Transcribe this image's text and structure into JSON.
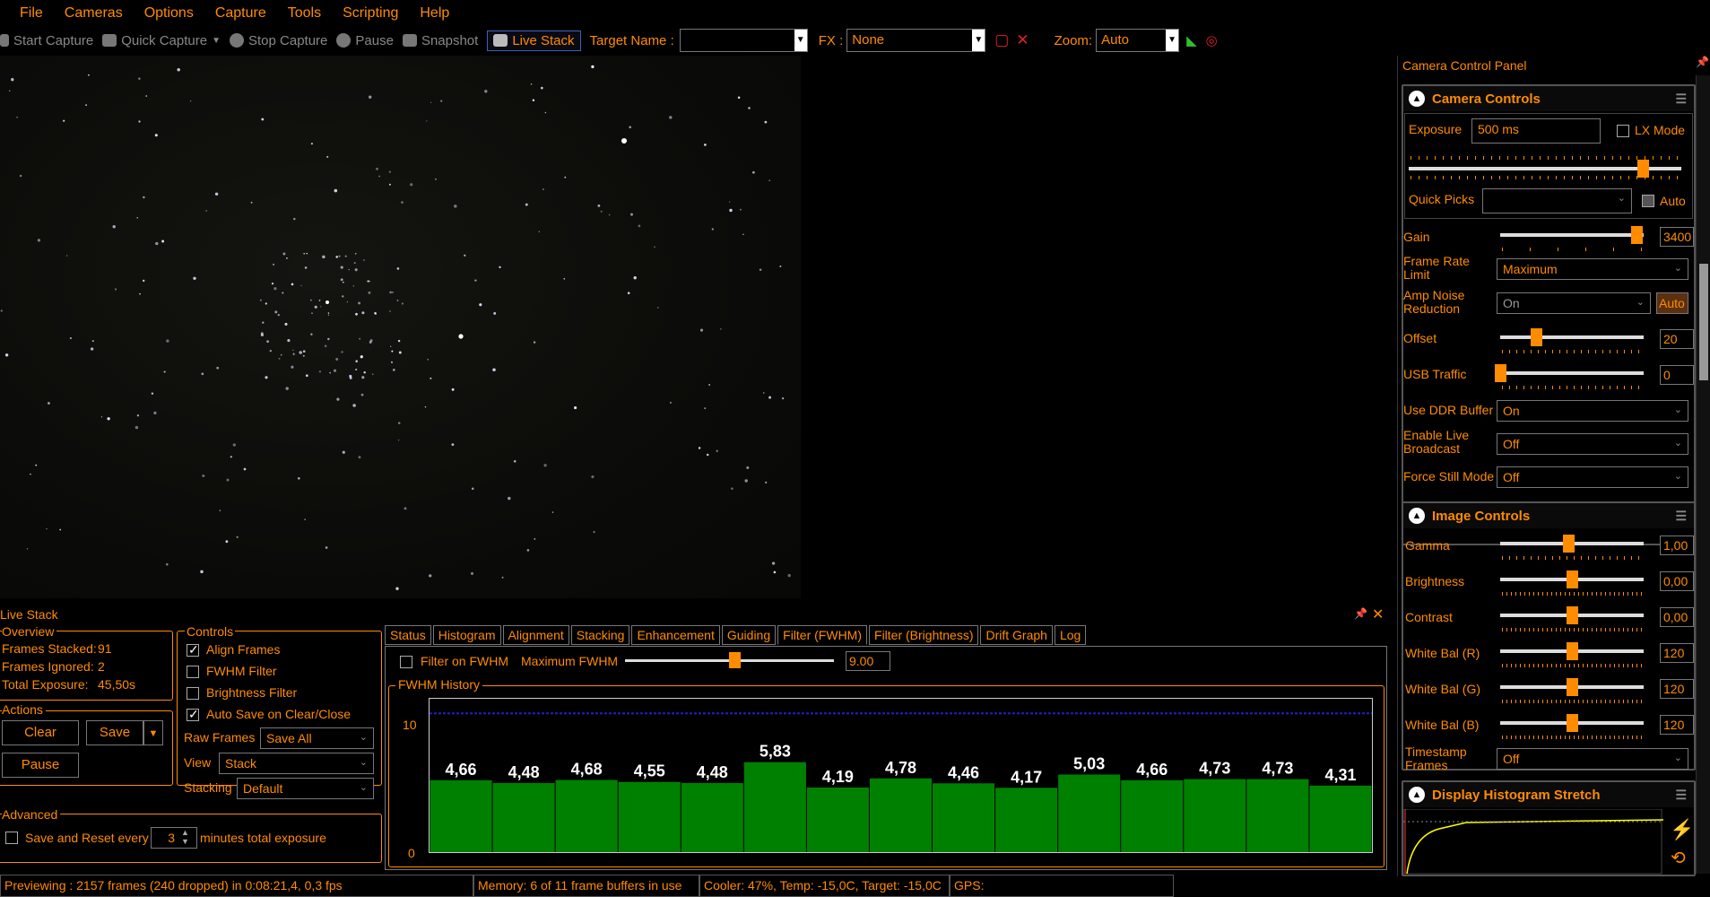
{
  "menu": [
    "File",
    "Cameras",
    "Options",
    "Capture",
    "Tools",
    "Scripting",
    "Help"
  ],
  "toolbar": {
    "start_capture": "Start Capture",
    "quick_capture": "Quick Capture",
    "stop_capture": "Stop Capture",
    "pause": "Pause",
    "snapshot": "Snapshot",
    "live_stack": "Live Stack",
    "target_label": "Target Name :",
    "target_value": "",
    "fx_label": "FX :",
    "fx_value": "None",
    "zoom_label": "Zoom:",
    "zoom_value": "Auto"
  },
  "camera_panel": {
    "title": "Camera Control Panel",
    "camera_controls": {
      "title": "Camera Controls",
      "exposure_label": "Exposure",
      "exposure_value": "500 ms",
      "lx_mode": "LX Mode",
      "quick_picks": "Quick Picks",
      "quick_picks_value": "",
      "auto": "Auto",
      "gain_label": "Gain",
      "gain_value": "3400",
      "frame_rate_label": "Frame Rate Limit",
      "frame_rate_value": "Maximum",
      "amp_noise_label": "Amp Noise Reduction",
      "amp_noise_value": "On",
      "amp_auto": "Auto",
      "offset_label": "Offset",
      "offset_value": "20",
      "usb_label": "USB Traffic",
      "usb_value": "0",
      "ddr_label": "Use DDR Buffer",
      "ddr_value": "On",
      "live_broadcast_label": "Enable Live Broadcast",
      "live_broadcast_value": "Off",
      "force_still_label": "Force Still Mode",
      "force_still_value": "Off"
    },
    "image_controls": {
      "title": "Image Controls",
      "gamma_label": "Gamma",
      "gamma_value": "1,00",
      "brightness_label": "Brightness",
      "brightness_value": "0,00",
      "contrast_label": "Contrast",
      "contrast_value": "0,00",
      "wbr_label": "White Bal (R)",
      "wbr_value": "120",
      "wbg_label": "White Bal (G)",
      "wbg_value": "120",
      "wbb_label": "White Bal (B)",
      "wbb_value": "120",
      "timestamp_label": "Timestamp Frames",
      "timestamp_value": "Off"
    },
    "histogram_stretch": {
      "title": "Display Histogram Stretch"
    }
  },
  "live_stack": {
    "title": "Live Stack",
    "overview": {
      "title": "Overview",
      "frames_stacked_label": "Frames Stacked:",
      "frames_stacked": "91",
      "frames_ignored_label": "Frames Ignored:",
      "frames_ignored": "2",
      "total_exposure_label": "Total Exposure:",
      "total_exposure": "45,50s"
    },
    "controls": {
      "title": "Controls",
      "align_frames": "Align Frames",
      "fwhm_filter": "FWHM Filter",
      "brightness_filter": "Brightness Filter",
      "auto_save": "Auto Save on Clear/Close",
      "raw_frames_label": "Raw Frames",
      "raw_frames_value": "Save All",
      "view_label": "View",
      "view_value": "Stack",
      "stacking_label": "Stacking",
      "stacking_value": "Default"
    },
    "actions": {
      "title": "Actions",
      "clear": "Clear",
      "save": "Save",
      "pause": "Pause"
    },
    "advanced": {
      "title": "Advanced",
      "save_reset_label": "Save and Reset every",
      "save_reset_value": "3",
      "minutes_label": "minutes total exposure"
    },
    "tabs": [
      "Status",
      "Histogram",
      "Alignment",
      "Stacking",
      "Enhancement",
      "Guiding",
      "Filter (FWHM)",
      "Filter (Brightness)",
      "Drift Graph",
      "Log"
    ],
    "active_tab": "Filter (FWHM)",
    "fwhm": {
      "filter_on_label": "Filter on FWHM",
      "max_label": "Maximum FWHM",
      "max_value": "9.00",
      "history_title": "FWHM History"
    }
  },
  "chart_data": {
    "type": "bar",
    "title": "FWHM History",
    "ylim": [
      0,
      10
    ],
    "y_ticks": [
      "10",
      "0"
    ],
    "threshold": 9.0,
    "values": [
      4.66,
      4.48,
      4.68,
      4.55,
      4.48,
      5.83,
      4.19,
      4.78,
      4.46,
      4.17,
      5.03,
      4.66,
      4.73,
      4.73,
      4.31
    ],
    "labels": [
      "4,66",
      "4,48",
      "4,68",
      "4,55",
      "4,48",
      "5,83",
      "4,19",
      "4,78",
      "4,46",
      "4,17",
      "5,03",
      "4,66",
      "4,73",
      "4,73",
      "4,31"
    ],
    "bar_color": "#008000"
  },
  "status": {
    "preview": "Previewing : 2157 frames (240 dropped) in 0:08:21,4, 0,3 fps",
    "memory": "Memory: 6 of 11 frame buffers in use",
    "cooler": "Cooler: 47%, Temp: -15,0C, Target: -15,0C",
    "gps": "GPS:"
  }
}
